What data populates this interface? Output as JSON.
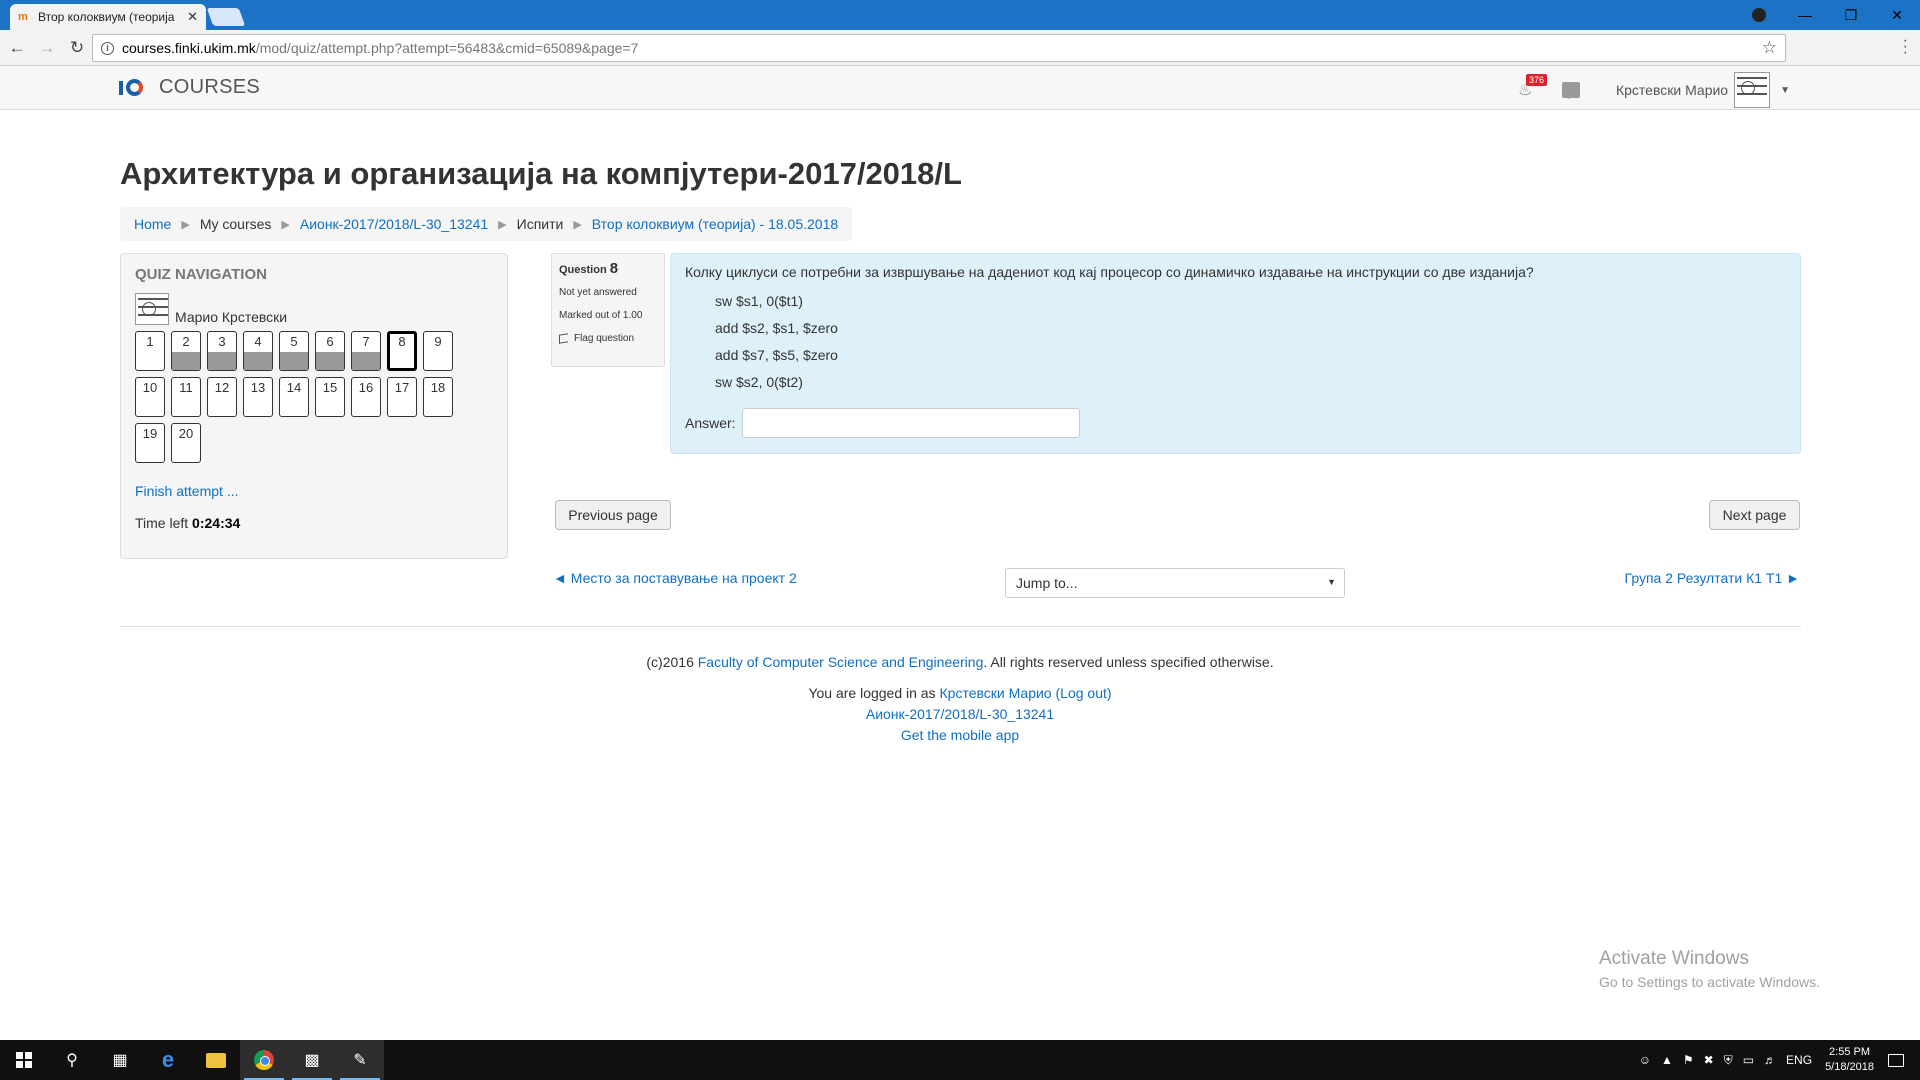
{
  "browser": {
    "tab_title": "Втор колоквиум (теорија",
    "tab_close": "✕",
    "url_host": "courses.finki.ukim.mk",
    "url_path": "/mod/quiz/attempt.php?attempt=56483&cmid=65089&page=7"
  },
  "header": {
    "brand": "COURSES",
    "notification_count": "376",
    "user_name": "Крстевски Марио"
  },
  "page_title": "Архитектура и организација на компјутери-2017/2018/L",
  "breadcrumb": {
    "home": "Home",
    "my_courses": "My courses",
    "course": "Аионк-2017/2018/L-30_13241",
    "section": "Испити",
    "quiz": "Втор колоквиум (теорија) - 18.05.2018"
  },
  "quiz_nav": {
    "title": "Quiz navigation",
    "user": "Марио Крстевски",
    "questions": [
      {
        "n": "1",
        "state": "unanswered"
      },
      {
        "n": "2",
        "state": "answered"
      },
      {
        "n": "3",
        "state": "answered"
      },
      {
        "n": "4",
        "state": "answered"
      },
      {
        "n": "5",
        "state": "answered"
      },
      {
        "n": "6",
        "state": "answered"
      },
      {
        "n": "7",
        "state": "answered"
      },
      {
        "n": "8",
        "state": "current"
      },
      {
        "n": "9",
        "state": "unanswered"
      },
      {
        "n": "10",
        "state": "unanswered"
      },
      {
        "n": "11",
        "state": "unanswered"
      },
      {
        "n": "12",
        "state": "unanswered"
      },
      {
        "n": "13",
        "state": "unanswered"
      },
      {
        "n": "14",
        "state": "unanswered"
      },
      {
        "n": "15",
        "state": "unanswered"
      },
      {
        "n": "16",
        "state": "unanswered"
      },
      {
        "n": "17",
        "state": "unanswered"
      },
      {
        "n": "18",
        "state": "unanswered"
      },
      {
        "n": "19",
        "state": "unanswered"
      },
      {
        "n": "20",
        "state": "unanswered"
      }
    ],
    "finish": "Finish attempt ...",
    "time_label": "Time left",
    "time_value": "0:24:34"
  },
  "question": {
    "label": "Question",
    "number": "8",
    "status": "Not yet answered",
    "marked": "Marked out of 1.00",
    "flag": "Flag question",
    "text": "Колку циклуси се потребни за извршување на дадениот код кај процесор со динамичко издавање  на инструкции со две изданија?",
    "code": [
      "sw $s1, 0($t1)",
      "add $s2, $s1, $zero",
      "add $s7, $s5, $zero",
      "sw $s2, 0($t2)"
    ],
    "answer_label": "Answer:",
    "answer_value": ""
  },
  "nav": {
    "previous": "Previous page",
    "next": "Next page",
    "prev_activity": "◄ Место за поставување на проект 2",
    "jump": "Jump to...",
    "next_activity": "Група 2 Резултати К1 Т1 ►"
  },
  "footer": {
    "copy_prefix": "(c)2016",
    "copy_link": "Faculty of Computer Science and Engineering",
    "copy_suffix": ". All rights reserved unless specified otherwise.",
    "logged_prefix": "You are logged in as",
    "logged_user": "Крстевски Марио",
    "logout": "(Log out)",
    "course_link": "Аионк-2017/2018/L-30_13241",
    "mobile": "Get the mobile app"
  },
  "watermark": {
    "line1": "Activate Windows",
    "line2": "Go to Settings to activate Windows."
  },
  "taskbar": {
    "lang": "ENG",
    "time": "2:55 PM",
    "date": "5/18/2018"
  }
}
